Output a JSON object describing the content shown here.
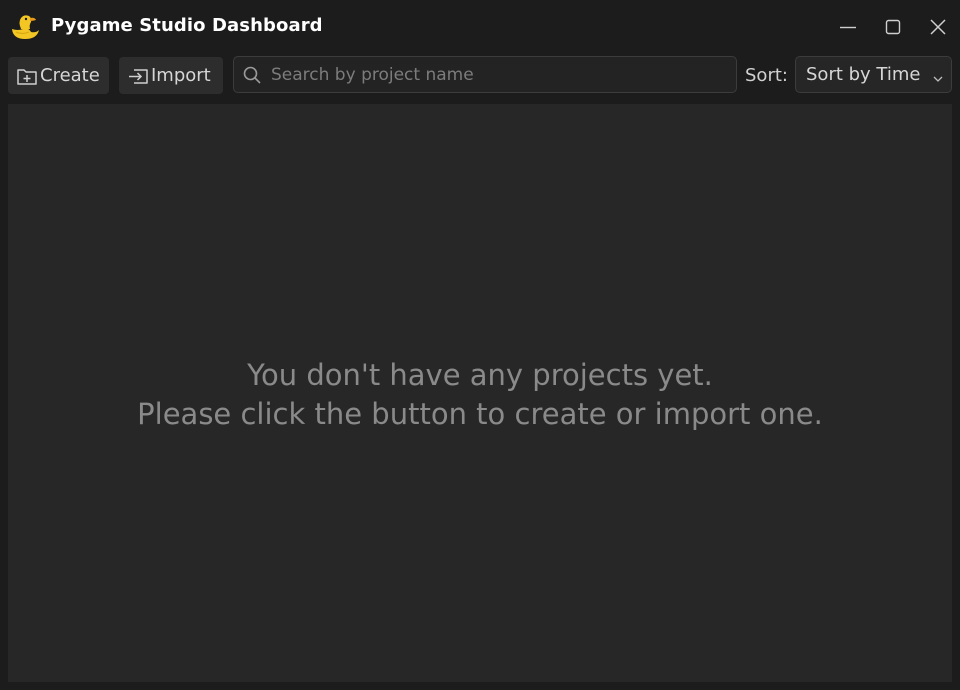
{
  "window": {
    "title": "Pygame Studio Dashboard",
    "logo_icon": "python-duck-logo-icon"
  },
  "window_controls": {
    "minimize_icon": "minimize-icon",
    "maximize_icon": "maximize-icon",
    "close_icon": "close-icon"
  },
  "toolbar": {
    "create_label": "Create",
    "create_icon": "folder-plus-icon",
    "import_label": "Import",
    "import_icon": "import-icon",
    "search_placeholder": "Search by project name",
    "search_value": "",
    "search_icon": "search-icon",
    "sort_label": "Sort:",
    "sort_selected": "Sort by Time",
    "sort_icon": "chevron-down-icon"
  },
  "empty_state": {
    "line1": "You don't have any projects yet.",
    "line2": "Please click the button to create or import one."
  },
  "colors": {
    "background": "#1c1c1c",
    "content": "#272727",
    "button": "#2d2d2d",
    "text_muted": "#8a8a8a",
    "logo_yellow": "#f3c623"
  }
}
